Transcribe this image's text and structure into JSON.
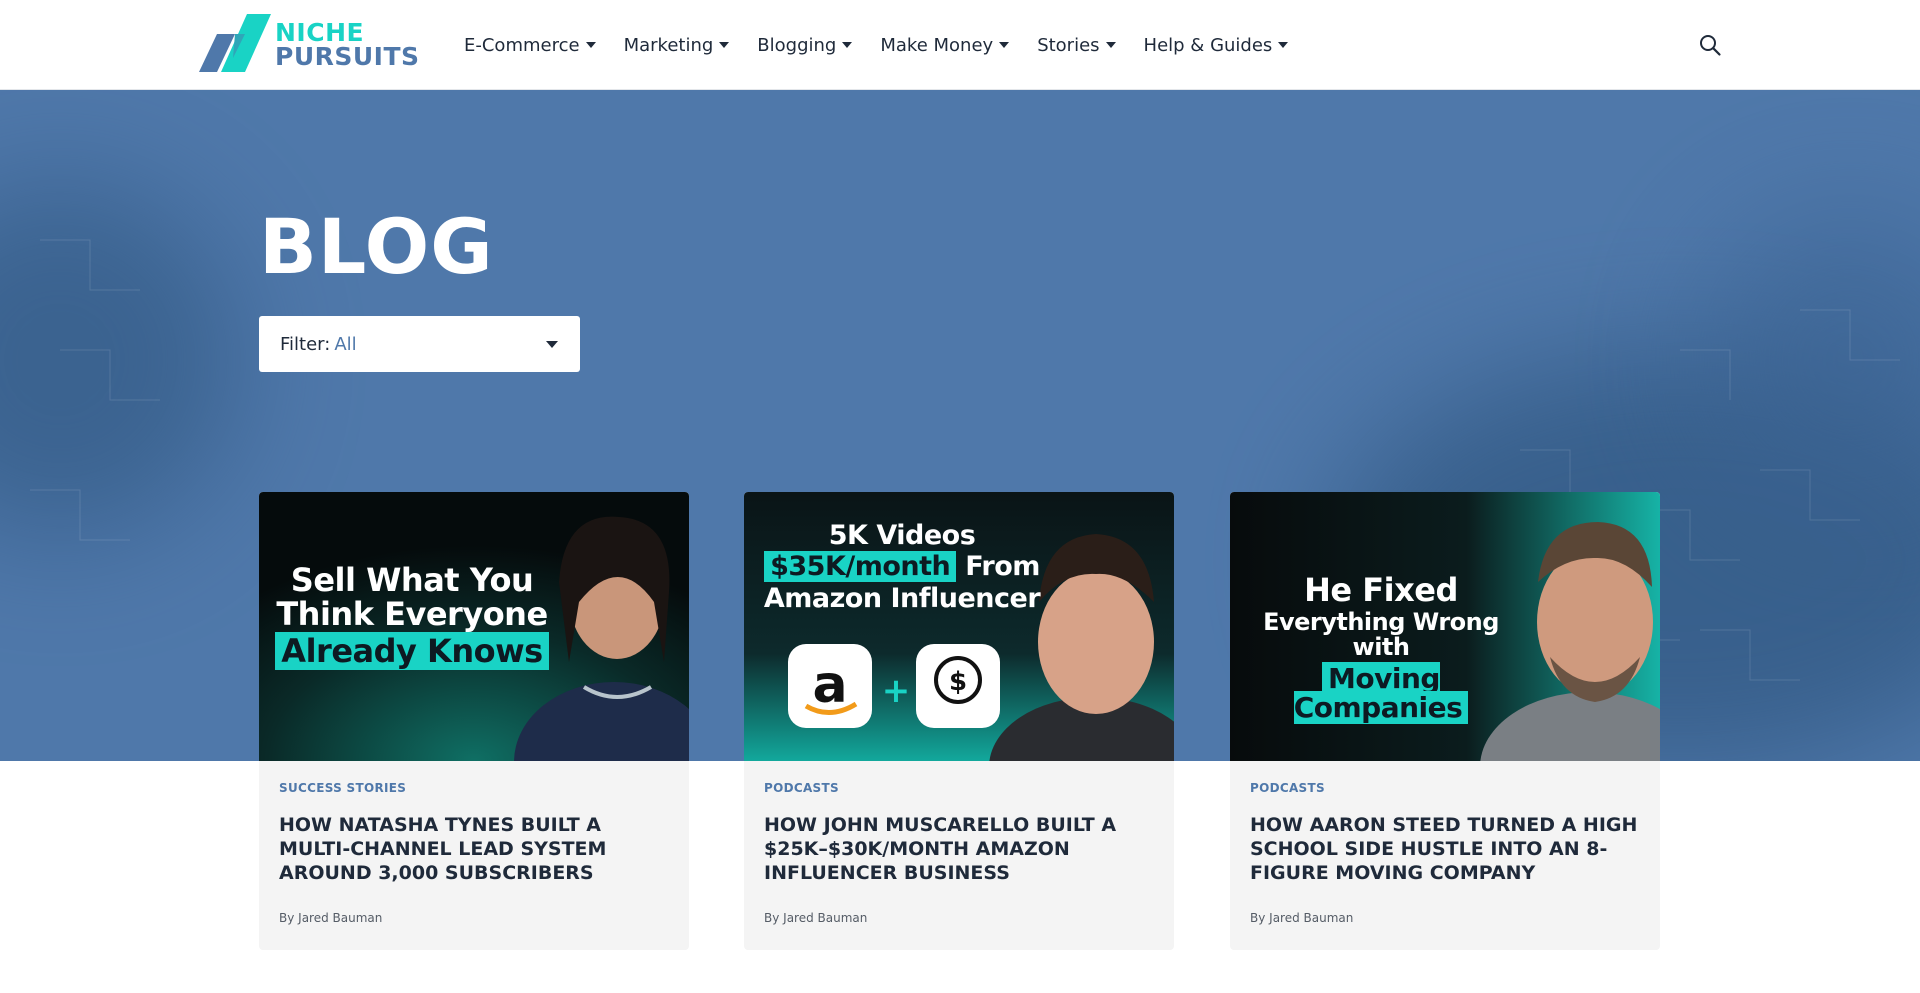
{
  "site": {
    "logo_line1": "NICHE",
    "logo_line2": "PURSUITS"
  },
  "nav": {
    "items": [
      {
        "label": "E-Commerce"
      },
      {
        "label": "Marketing"
      },
      {
        "label": "Blogging"
      },
      {
        "label": "Make Money"
      },
      {
        "label": "Stories"
      },
      {
        "label": "Help & Guides"
      }
    ],
    "search_icon": "search-icon"
  },
  "hero": {
    "title": "BLOG",
    "filter_label": "Filter:",
    "filter_value": "All"
  },
  "colors": {
    "brand_blue": "#4f78aa",
    "brand_teal": "#19d3c5",
    "text_dark": "#1f2a3a"
  },
  "cards": [
    {
      "thumb": {
        "line1": "Sell What You",
        "line2": "Think Everyone",
        "line3": "Already Knows"
      },
      "category": "SUCCESS STORIES",
      "title": "HOW NATASHA TYNES BUILT A MULTI-CHANNEL LEAD SYSTEM AROUND 3,000 SUBSCRIBERS",
      "author": "By Jared Bauman"
    },
    {
      "thumb": {
        "line1": "5K Videos",
        "line2_hl": "$35K/month",
        "line2_rest": "From",
        "line3": "Amazon Influencer"
      },
      "category": "PODCASTS",
      "title": "HOW JOHN MUSCARELLO BUILT A $25K–$30K/MONTH AMAZON INFLUENCER BUSINESS",
      "author": "By Jared Bauman"
    },
    {
      "thumb": {
        "line1": "He Fixed",
        "line2": "Everything Wrong with",
        "line3": "Moving Companies"
      },
      "category": "PODCASTS",
      "title": "HOW AARON STEED TURNED A HIGH SCHOOL SIDE HUSTLE INTO AN 8-FIGURE MOVING COMPANY",
      "author": "By Jared Bauman"
    }
  ]
}
